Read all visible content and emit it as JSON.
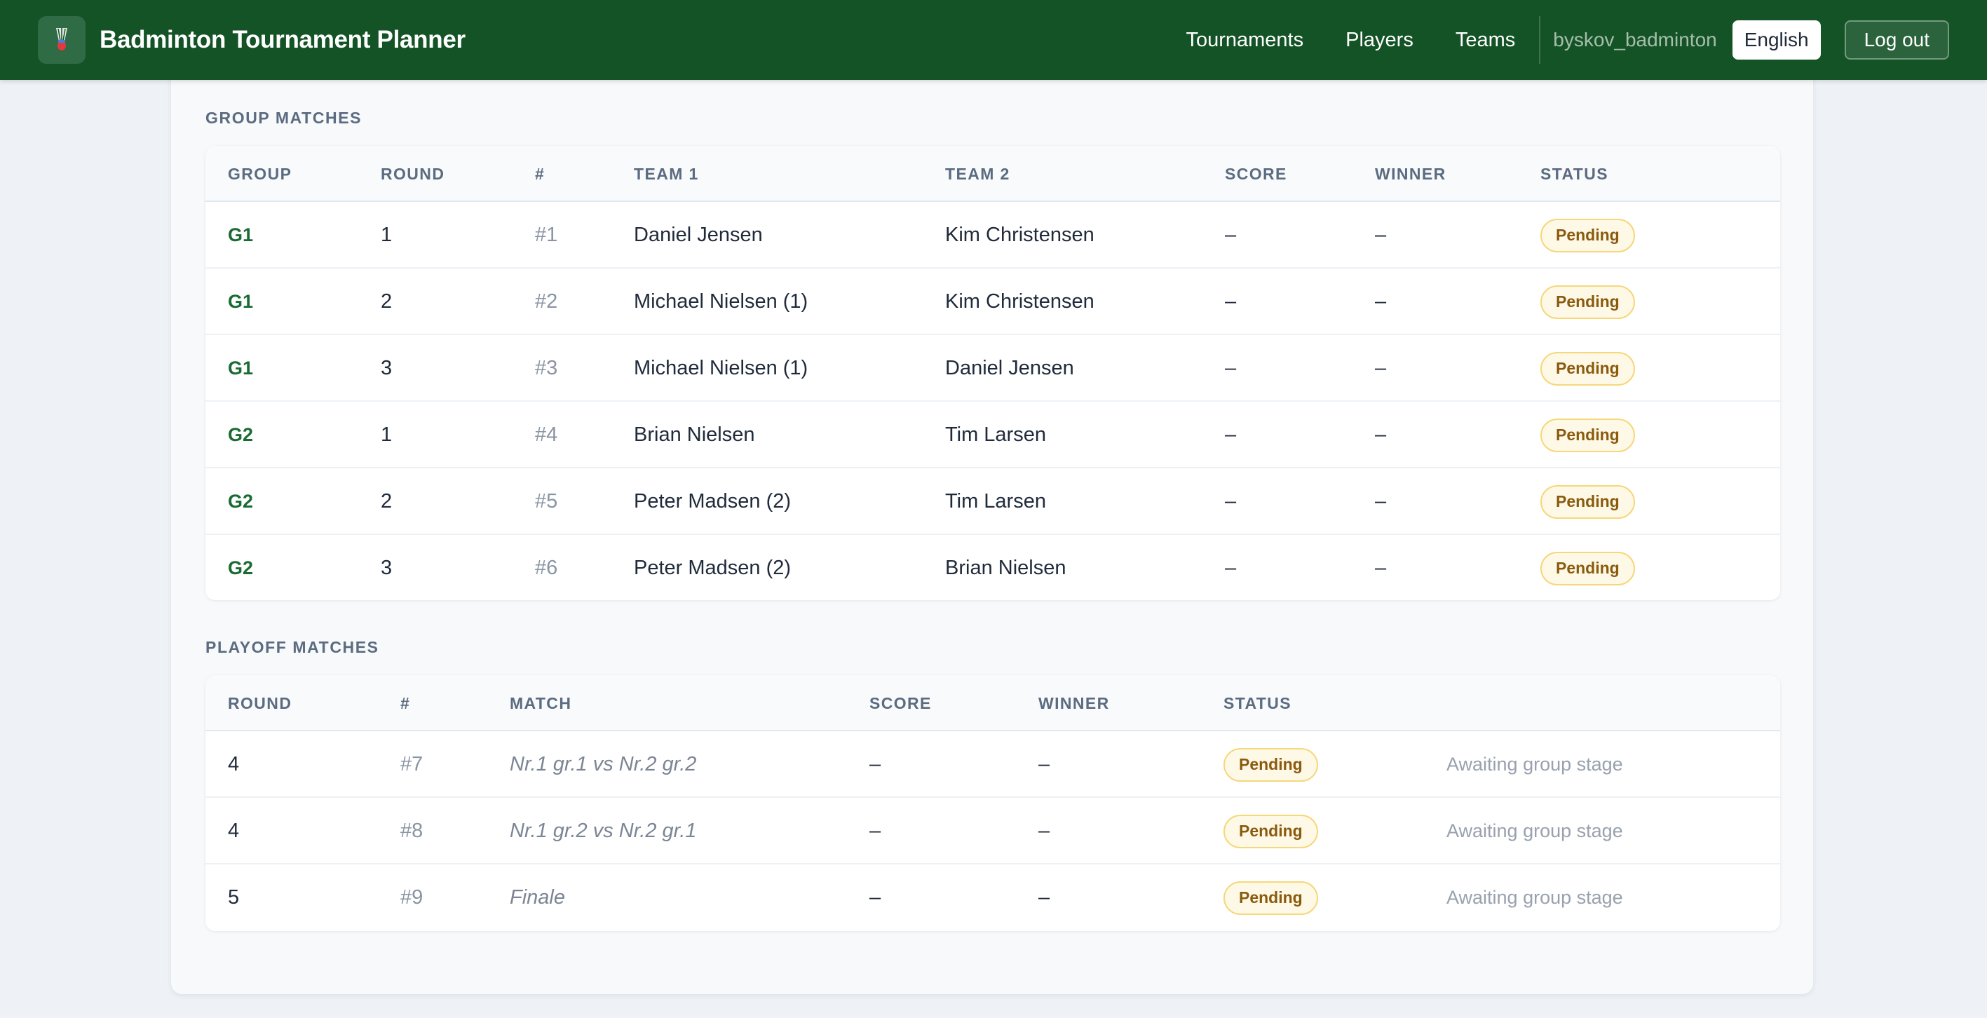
{
  "header": {
    "logo_icon": "shuttlecock-icon",
    "brand": "Badminton Tournament Planner",
    "nav": [
      {
        "label": "Tournaments"
      },
      {
        "label": "Players"
      },
      {
        "label": "Teams"
      }
    ],
    "username": "byskov_badminton",
    "language": "English",
    "logout": "Log out"
  },
  "group_matches": {
    "title": "GROUP MATCHES",
    "columns": [
      "GROUP",
      "ROUND",
      "#",
      "TEAM 1",
      "TEAM 2",
      "SCORE",
      "WINNER",
      "STATUS"
    ],
    "rows": [
      {
        "group": "G1",
        "round": "1",
        "num": "#1",
        "team1": "Daniel Jensen",
        "team2": "Kim Christensen",
        "score": "–",
        "winner": "–",
        "status": "Pending"
      },
      {
        "group": "G1",
        "round": "2",
        "num": "#2",
        "team1": "Michael Nielsen (1)",
        "team2": "Kim Christensen",
        "score": "–",
        "winner": "–",
        "status": "Pending"
      },
      {
        "group": "G1",
        "round": "3",
        "num": "#3",
        "team1": "Michael Nielsen (1)",
        "team2": "Daniel Jensen",
        "score": "–",
        "winner": "–",
        "status": "Pending"
      },
      {
        "group": "G2",
        "round": "1",
        "num": "#4",
        "team1": "Brian Nielsen",
        "team2": "Tim Larsen",
        "score": "–",
        "winner": "–",
        "status": "Pending"
      },
      {
        "group": "G2",
        "round": "2",
        "num": "#5",
        "team1": "Peter Madsen (2)",
        "team2": "Tim Larsen",
        "score": "–",
        "winner": "–",
        "status": "Pending"
      },
      {
        "group": "G2",
        "round": "3",
        "num": "#6",
        "team1": "Peter Madsen (2)",
        "team2": "Brian Nielsen",
        "score": "–",
        "winner": "–",
        "status": "Pending"
      }
    ]
  },
  "playoff_matches": {
    "title": "PLAYOFF MATCHES",
    "columns": [
      "ROUND",
      "#",
      "MATCH",
      "SCORE",
      "WINNER",
      "STATUS"
    ],
    "rows": [
      {
        "round": "4",
        "num": "#7",
        "match": "Nr.1 gr.1 vs Nr.2 gr.2",
        "score": "–",
        "winner": "–",
        "status": "Pending",
        "note": "Awaiting group stage"
      },
      {
        "round": "4",
        "num": "#8",
        "match": "Nr.1 gr.2 vs Nr.2 gr.1",
        "score": "–",
        "winner": "–",
        "status": "Pending",
        "note": "Awaiting group stage"
      },
      {
        "round": "5",
        "num": "#9",
        "match": "Finale",
        "score": "–",
        "winner": "–",
        "status": "Pending",
        "note": "Awaiting group stage"
      }
    ]
  },
  "colors": {
    "header_bg": "#145326",
    "group_label": "#1a6b32",
    "badge_bg": "#fef9e7",
    "badge_border": "#f6d779",
    "badge_text": "#8a5a0d"
  }
}
